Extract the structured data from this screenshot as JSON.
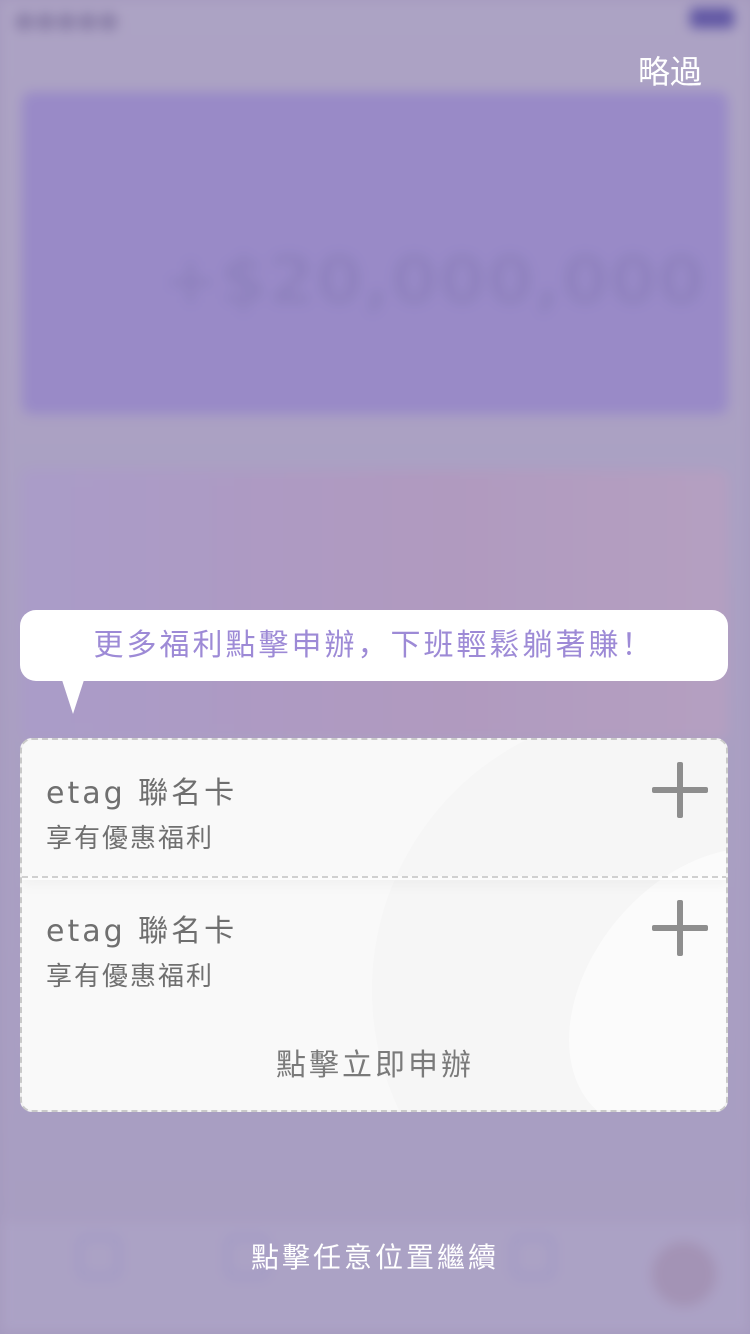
{
  "overlay": {
    "skip_label": "略過",
    "tooltip_text": "更多福利點擊申辦，下班輕鬆躺著賺！",
    "continue_hint": "點擊任意位置繼續"
  },
  "cards": [
    {
      "title": "etag 聯名卡",
      "subtitle": "享有優惠福利"
    },
    {
      "title": "etag 聯名卡",
      "subtitle": "享有優惠福利",
      "apply_label": "點擊立即申辦"
    }
  ],
  "background": {
    "account_balance": "+$20,000,000"
  },
  "colors": {
    "tooltip_text": "#9d8ad6",
    "overlay_tint": "#7869a0"
  },
  "icons": [
    "plus-icon",
    "plus-icon"
  ]
}
